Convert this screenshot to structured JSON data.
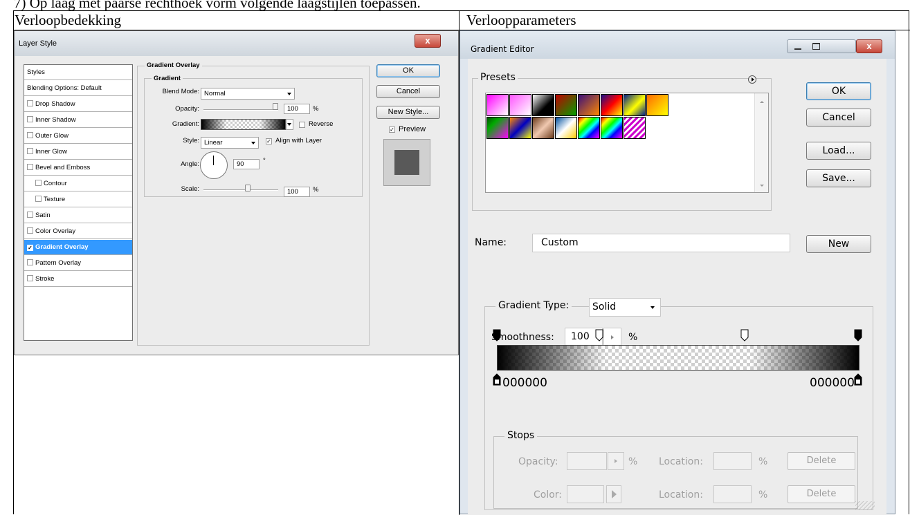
{
  "document": {
    "caption": "7) Op laag met paarse rechthoek vorm volgende laagstijlen toepassen.",
    "col1_header": "Verloopbedekking",
    "col2_header": "Verloopparameters"
  },
  "layer_style": {
    "title": "Layer Style",
    "close": "x",
    "styles_header": "Styles",
    "items": [
      {
        "label": "Blending Options: Default",
        "checkbox": false,
        "checked": false,
        "selected": false,
        "indent": false
      },
      {
        "label": "Drop Shadow",
        "checkbox": true,
        "checked": false,
        "selected": false,
        "indent": false
      },
      {
        "label": "Inner Shadow",
        "checkbox": true,
        "checked": false,
        "selected": false,
        "indent": false
      },
      {
        "label": "Outer Glow",
        "checkbox": true,
        "checked": false,
        "selected": false,
        "indent": false
      },
      {
        "label": "Inner Glow",
        "checkbox": true,
        "checked": false,
        "selected": false,
        "indent": false
      },
      {
        "label": "Bevel and Emboss",
        "checkbox": true,
        "checked": false,
        "selected": false,
        "indent": false
      },
      {
        "label": "Contour",
        "checkbox": true,
        "checked": false,
        "selected": false,
        "indent": true
      },
      {
        "label": "Texture",
        "checkbox": true,
        "checked": false,
        "selected": false,
        "indent": true
      },
      {
        "label": "Satin",
        "checkbox": true,
        "checked": false,
        "selected": false,
        "indent": false
      },
      {
        "label": "Color Overlay",
        "checkbox": true,
        "checked": false,
        "selected": false,
        "indent": false
      },
      {
        "label": "Gradient Overlay",
        "checkbox": true,
        "checked": true,
        "selected": true,
        "indent": false
      },
      {
        "label": "Pattern Overlay",
        "checkbox": true,
        "checked": false,
        "selected": false,
        "indent": false
      },
      {
        "label": "Stroke",
        "checkbox": true,
        "checked": false,
        "selected": false,
        "indent": false
      }
    ],
    "section_title": "Gradient Overlay",
    "subsection_title": "Gradient",
    "blend_mode_label": "Blend Mode:",
    "blend_mode_value": "Normal",
    "opacity_label": "Opacity:",
    "opacity_value": "100",
    "opacity_unit": "%",
    "gradient_label": "Gradient:",
    "reverse_label": "Reverse",
    "reverse_checked": false,
    "style_label": "Style:",
    "style_value": "Linear",
    "align_label": "Align with Layer",
    "align_checked": true,
    "angle_label": "Angle:",
    "angle_value": "90",
    "angle_unit": "°",
    "scale_label": "Scale:",
    "scale_value": "100",
    "scale_unit": "%",
    "ok": "OK",
    "cancel": "Cancel",
    "new_style": "New Style...",
    "preview_label": "Preview",
    "preview_checked": true
  },
  "gradient_editor": {
    "title": "Gradient Editor",
    "presets_label": "Presets",
    "ok": "OK",
    "cancel": "Cancel",
    "load": "Load...",
    "save": "Save...",
    "name_label": "Name:",
    "name_value": "Custom",
    "new": "New",
    "gradient_type_label": "Gradient Type:",
    "gradient_type_value": "Solid",
    "smoothness_label": "Smoothness:",
    "smoothness_value": "100",
    "smoothness_unit": "%",
    "left_color": "000000",
    "right_color": "000000",
    "stops_label": "Stops",
    "opacity_label": "Opacity:",
    "opacity_unit": "%",
    "location_label": "Location:",
    "location_unit": "%",
    "color_label": "Color:",
    "delete": "Delete",
    "presets": [
      "linear-gradient(135deg,#ff00ff,#ffffff)",
      "linear-gradient(135deg,#ff55ff,#ffffff)",
      "linear-gradient(135deg,#ffffff,#000000 60%)",
      "linear-gradient(135deg,#c00000,#00a000)",
      "linear-gradient(135deg,#3b0f7a,#ff8800)",
      "linear-gradient(135deg,#1a0e8a,#ff0000 50%,#ffff00)",
      "linear-gradient(135deg,#00208a,#ffff00 55%,#00208a)",
      "linear-gradient(135deg,#ff6a00,#ffff00)",
      "linear-gradient(135deg,#005500,#00aa00 30%,#ff00ff)",
      "linear-gradient(135deg,#ff8800,#0000c0 50%,#ffff00)",
      "linear-gradient(135deg,#6b3b1b,#f0c8b0 50%,#6b3b1b)",
      "linear-gradient(135deg,#0050a0,#ffffff 50%,#ffcc00)",
      "linear-gradient(135deg,#ff0000,#ffff00 20%,#00ff00 40%,#00ffff 55%,#0000ff 70%,#ff00ff)",
      "linear-gradient(135deg,#ff0000,#ffff00 20%,#00ff00 40%,#00ffff 55%,#0000ff 70%,#ff00ff)",
      "repeating-linear-gradient(135deg,#cc00cc 0 3px,#ffffff 3px 6px)"
    ]
  }
}
